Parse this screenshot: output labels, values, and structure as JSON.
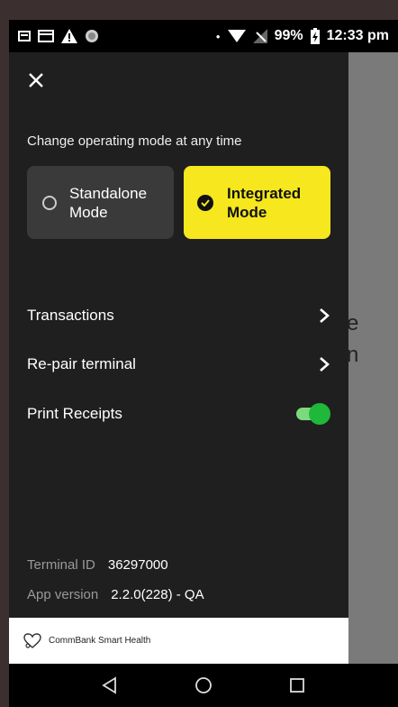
{
  "status_bar": {
    "battery": "99%",
    "time": "12:33 pm"
  },
  "drawer": {
    "mode_caption": "Change operating mode at any time",
    "modes": [
      {
        "label": "Standalone\nMode",
        "selected": false
      },
      {
        "label": "Integrated\nMode",
        "selected": true
      }
    ],
    "menu": [
      {
        "label": "Transactions"
      },
      {
        "label": "Re-pair terminal"
      },
      {
        "label": "Print Receipts",
        "toggle_on": true
      }
    ],
    "terminal_id_label": "Terminal ID",
    "terminal_id_value": "36297000",
    "app_version_label": "App version",
    "app_version_value": "2.2.0(228) - QA",
    "brand": "CommBank Smart Health"
  },
  "background_fragments": [
    "e",
    "n"
  ],
  "colors": {
    "selected_mode": "#f6e71e",
    "drawer_bg": "#1f1f1f",
    "toggle_on": "#1fb83a"
  }
}
